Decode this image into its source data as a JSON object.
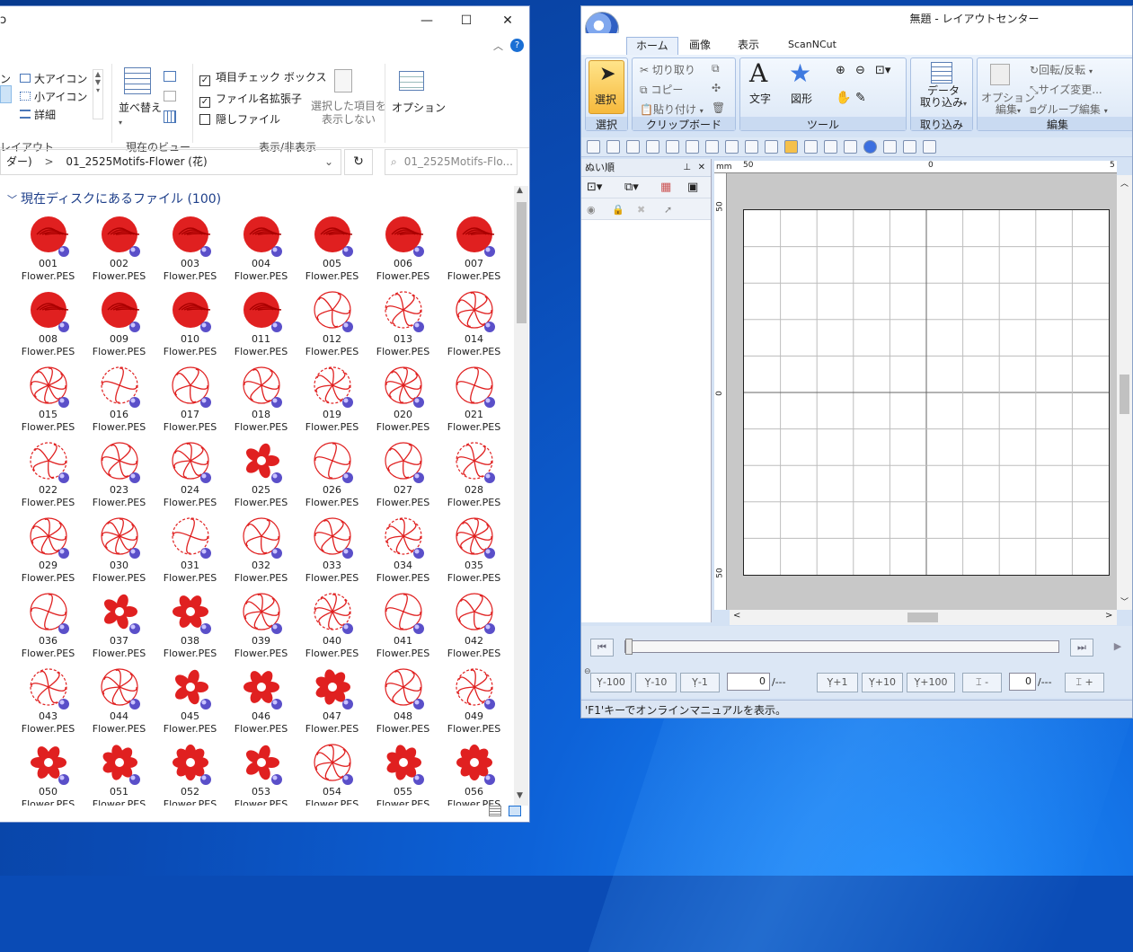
{
  "explorer": {
    "ribbon": {
      "layout_items": [
        "ン",
        "大アイコン",
        "小アイコン",
        "詳細"
      ],
      "layout_group": "レイアウト",
      "sort_label": "並べ替え",
      "current_view_group": "現在のビュー",
      "checkboxes": [
        {
          "label": "項目チェック ボックス",
          "checked": true
        },
        {
          "label": "ファイル名拡張子",
          "checked": true
        },
        {
          "label": "隠しファイル",
          "checked": false
        }
      ],
      "hide_selected": "選択した項目を",
      "hide_selected_2": "表示しない",
      "show_hide_group": "表示/非表示",
      "options_label": "オプション"
    },
    "address": {
      "path_prefix": "ダー)",
      "separator": ">",
      "folder": "01_2525Motifs-Flower (花)",
      "search_placeholder": "01_2525Motifs-Flo..."
    },
    "group_header": "現在ディスクにあるファイル (100)",
    "file_suffix": "Flower.PES",
    "files": [
      "001",
      "002",
      "003",
      "004",
      "005",
      "006",
      "007",
      "008",
      "009",
      "010",
      "011",
      "012",
      "013",
      "014",
      "015",
      "016",
      "017",
      "018",
      "019",
      "020",
      "021",
      "022",
      "023",
      "024",
      "025",
      "026",
      "027",
      "028",
      "029",
      "030",
      "031",
      "032",
      "033",
      "034",
      "035",
      "036",
      "037",
      "038",
      "039",
      "040",
      "041",
      "042",
      "043",
      "044",
      "045",
      "046",
      "047",
      "048",
      "049",
      "050",
      "051",
      "052",
      "053",
      "054",
      "055",
      "056"
    ]
  },
  "layout_center": {
    "title": "無題 - レイアウトセンター",
    "tabs": [
      "ホーム",
      "画像",
      "表示",
      "ScanNCut"
    ],
    "ribbon": {
      "select": "選択",
      "select_group": "選択",
      "cut": "切り取り",
      "copy": "コピー",
      "paste": "貼り付け",
      "clipboard_group": "クリップボード",
      "text": "文字",
      "shape": "図形",
      "tools_group": "ツール",
      "import_1": "データ",
      "import_2": "取り込み",
      "import_group": "取り込み",
      "option_1": "オプション",
      "option_2": "編集",
      "rotate": "回転/反転",
      "resize": "サイズ変更...",
      "group_edit": "グループ編集",
      "edit_group": "編集"
    },
    "panel_title": "ぬい順",
    "ruler": {
      "h_left": "50",
      "h_mid": "0",
      "h_right": "5",
      "unit": "mm",
      "v_top": "50",
      "v_mid": "0",
      "v_bottom": "50"
    },
    "steppers": [
      "-100",
      "-10",
      "-1",
      "+1",
      "+10",
      "+100"
    ],
    "stitch_value": "0",
    "stitch_total": "/---",
    "color_minus": "-",
    "color_plus": "+",
    "color_value": "0",
    "color_total": "/---",
    "status": "'F1'キーでオンラインマニュアルを表示。"
  },
  "colors": {
    "accent": "#e02020",
    "ribbon_blue": "#d4e2f4"
  }
}
